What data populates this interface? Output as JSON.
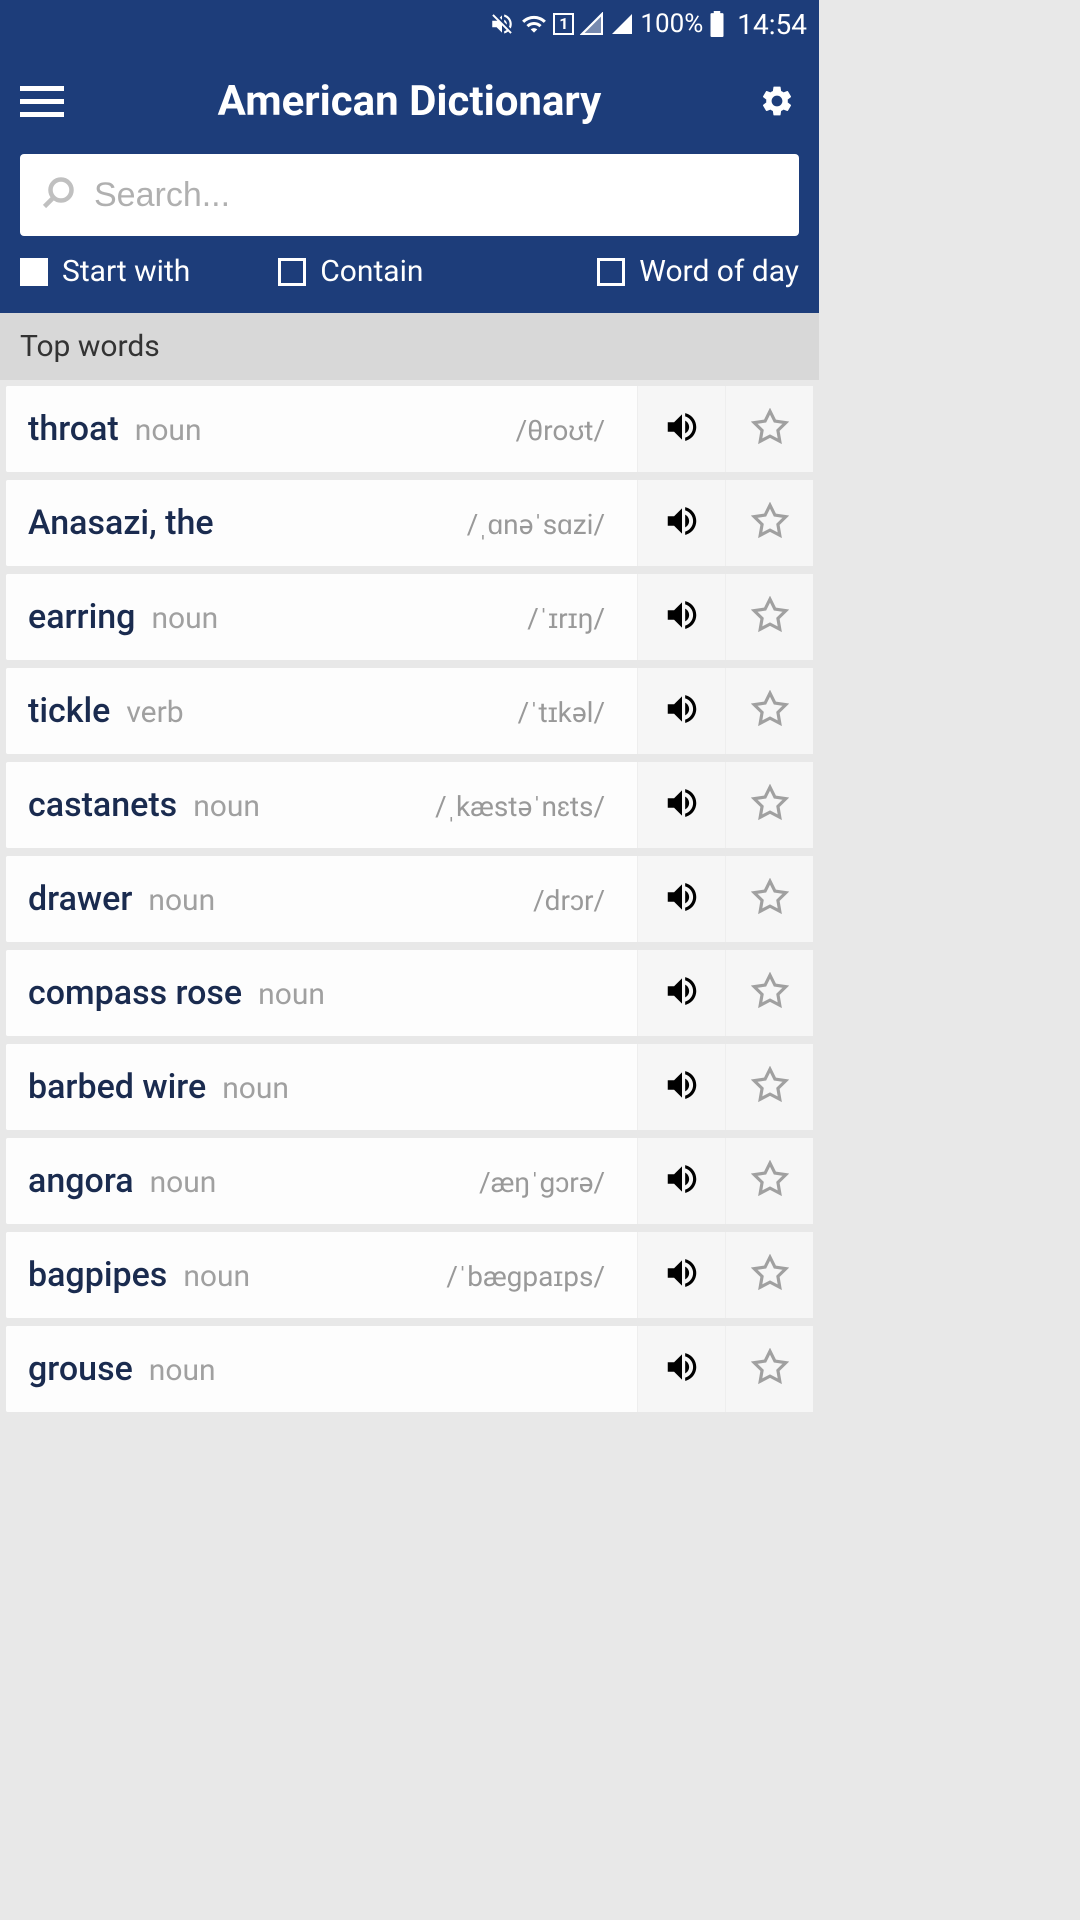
{
  "status": {
    "battery": "100%",
    "time": "14:54",
    "sim": "1"
  },
  "header": {
    "title": "American Dictionary"
  },
  "search": {
    "placeholder": "Search...",
    "value": ""
  },
  "filters": {
    "start_with": {
      "label": "Start with",
      "checked": true
    },
    "contain": {
      "label": "Contain",
      "checked": false
    },
    "word_of_day": {
      "label": "Word of day",
      "checked": false
    }
  },
  "section": {
    "title": "Top words"
  },
  "words": [
    {
      "word": "throat",
      "pos": "noun",
      "phonetic": "/θroʊt/"
    },
    {
      "word": "Anasazi, the",
      "pos": "",
      "phonetic": "/ˌɑnəˈsɑzi/"
    },
    {
      "word": "earring",
      "pos": "noun",
      "phonetic": "/ˈɪrɪŋ/"
    },
    {
      "word": "tickle",
      "pos": "verb",
      "phonetic": "/ˈtɪkəl/"
    },
    {
      "word": "castanets",
      "pos": "noun",
      "phonetic": "/ˌkæstəˈnɛts/"
    },
    {
      "word": "drawer",
      "pos": "noun",
      "phonetic": "/drɔr/"
    },
    {
      "word": "compass rose",
      "pos": "noun",
      "phonetic": ""
    },
    {
      "word": "barbed wire",
      "pos": "noun",
      "phonetic": ""
    },
    {
      "word": "angora",
      "pos": "noun",
      "phonetic": "/æŋˈgɔrə/"
    },
    {
      "word": "bagpipes",
      "pos": "noun",
      "phonetic": "/ˈbægpaɪps/"
    },
    {
      "word": "grouse",
      "pos": "noun",
      "phonetic": ""
    }
  ]
}
